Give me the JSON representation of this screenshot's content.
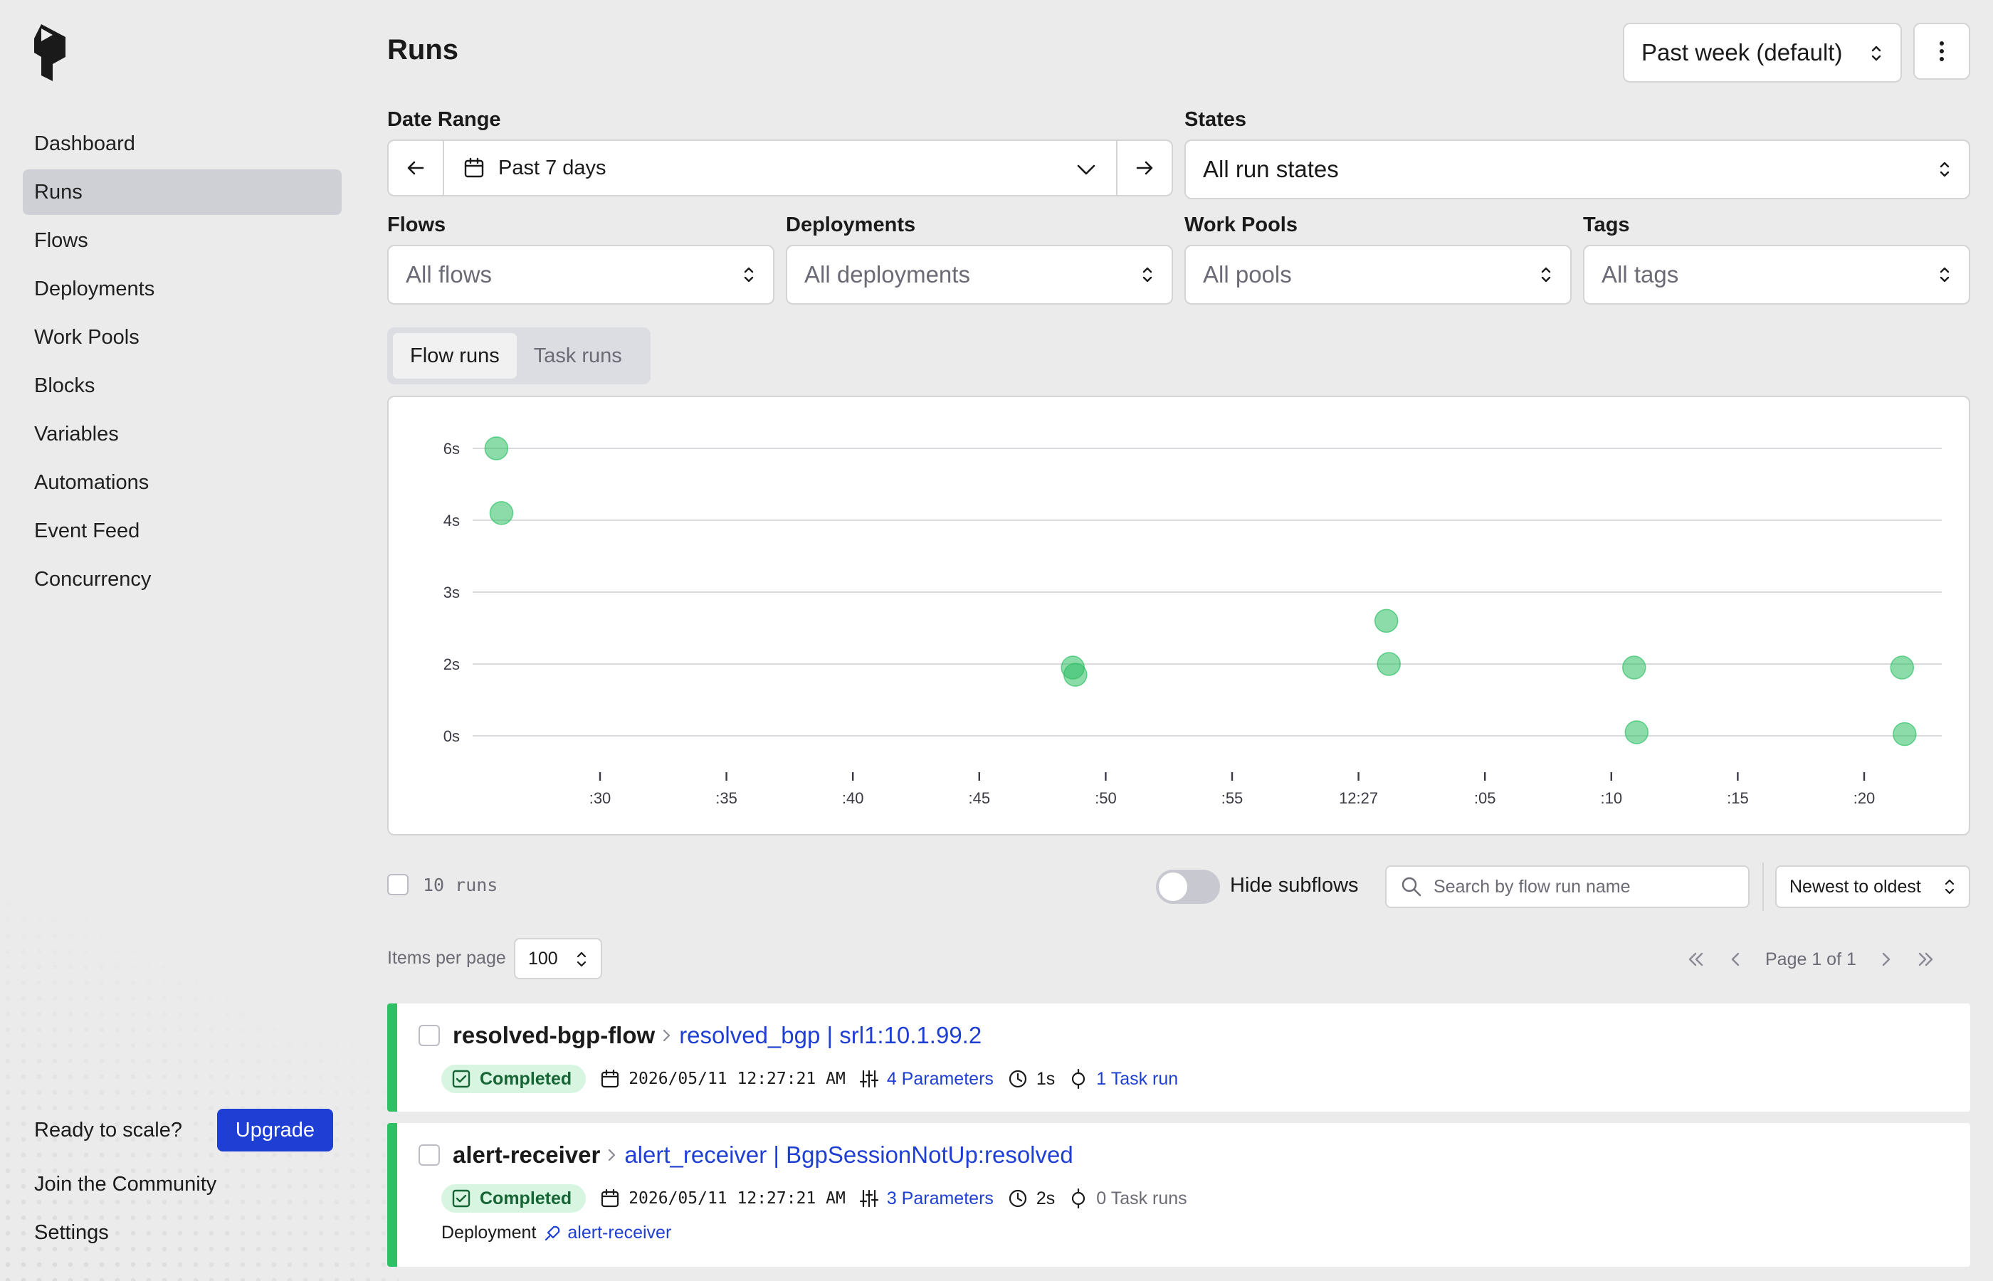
{
  "sidebar": {
    "nav": [
      {
        "label": "Dashboard",
        "active": false
      },
      {
        "label": "Runs",
        "active": true
      },
      {
        "label": "Flows",
        "active": false
      },
      {
        "label": "Deployments",
        "active": false
      },
      {
        "label": "Work Pools",
        "active": false
      },
      {
        "label": "Blocks",
        "active": false
      },
      {
        "label": "Variables",
        "active": false
      },
      {
        "label": "Automations",
        "active": false
      },
      {
        "label": "Event Feed",
        "active": false
      },
      {
        "label": "Concurrency",
        "active": false
      }
    ],
    "scale_text": "Ready to scale?",
    "upgrade_label": "Upgrade",
    "community_label": "Join the Community",
    "settings_label": "Settings"
  },
  "header": {
    "title": "Runs",
    "range_select": "Past week (default)"
  },
  "filters": {
    "date_range_label": "Date Range",
    "date_range_value": "Past 7 days",
    "states_label": "States",
    "states_value": "All run states",
    "flows_label": "Flows",
    "flows_value": "All flows",
    "deployments_label": "Deployments",
    "deployments_value": "All deployments",
    "work_pools_label": "Work Pools",
    "work_pools_value": "All pools",
    "tags_label": "Tags",
    "tags_value": "All tags"
  },
  "tabs": [
    {
      "label": "Flow runs",
      "active": true
    },
    {
      "label": "Task runs",
      "active": false
    }
  ],
  "chart_data": {
    "type": "scatter",
    "x_ticks": [
      ":30",
      ":35",
      ":40",
      ":45",
      ":50",
      ":55",
      "12:27",
      ":05",
      ":10",
      ":15",
      ":20"
    ],
    "y_ticks": [
      "6s",
      "4s",
      "3s",
      "2s",
      "0s"
    ],
    "point_color": "#2ec064",
    "points": [
      {
        "x": 25.9,
        "y": "6s"
      },
      {
        "x": 26.1,
        "y": "4.2s"
      },
      {
        "x": 48.7,
        "y": "1.9s"
      },
      {
        "x": 48.8,
        "y": "1.7s"
      },
      {
        "x": 61.1,
        "y": "2.6s"
      },
      {
        "x": 61.2,
        "y": "2s"
      },
      {
        "x": 70.9,
        "y": "1.9s"
      },
      {
        "x": 71.0,
        "y": "0.1s"
      },
      {
        "x": 81.5,
        "y": "1.9s"
      },
      {
        "x": 81.6,
        "y": "0.05s"
      }
    ]
  },
  "list": {
    "count_text": "10 runs",
    "hide_subflows_label": "Hide subflows",
    "search_placeholder": "Search by flow run name",
    "sort_value": "Newest to oldest",
    "items_per_page_label": "Items per page",
    "items_per_page_value": "100",
    "page_text": "Page 1 of 1"
  },
  "runs": [
    {
      "flow_name": "resolved-bgp-flow",
      "run_name": "resolved_bgp | srl1:10.1.99.2",
      "state": "Completed",
      "timestamp": "2026/05/11 12:27:21 AM",
      "parameters": "4 Parameters",
      "duration": "1s",
      "task_runs": "1 Task run"
    },
    {
      "flow_name": "alert-receiver",
      "run_name": "alert_receiver | BgpSessionNotUp:resolved",
      "state": "Completed",
      "timestamp": "2026/05/11 12:27:21 AM",
      "parameters": "3 Parameters",
      "duration": "2s",
      "task_runs": "0 Task runs",
      "deployment_label": "Deployment",
      "deployment_name": "alert-receiver"
    }
  ],
  "colors": {
    "accent": "#1f3fd4",
    "completed": "#2ec064",
    "badge_bg": "#d8f5e1"
  }
}
